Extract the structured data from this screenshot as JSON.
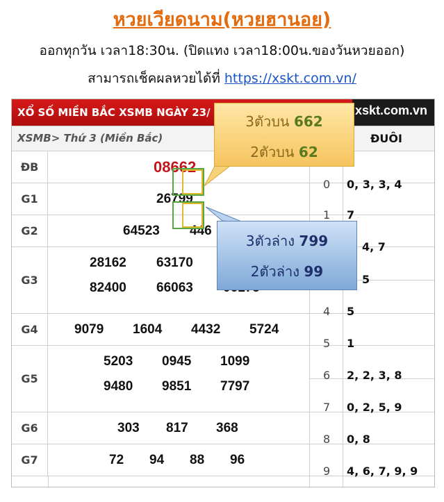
{
  "header": {
    "title": "หวยเวียดนาม(หวยฮานอย)",
    "schedule": "ออกทุกวัน เวลา18:30น. (ปิดแทง เวลา18:00น.ของวันหวยออก)",
    "check_text": "สามารถเช็คผลหวยได้ที่ ",
    "check_link": "https://xskt.com.vn/"
  },
  "board": {
    "banner": "XỔ SỐ MIỀN BẮC XSMB NGÀY 23/",
    "logo": "xskt.com.vn",
    "subheader": "XSMB> Thứ 3 (Miền Bắc)",
    "duoi_header": "ĐUÔI",
    "prizes": [
      {
        "label": "ĐB",
        "numbers": [
          "08662"
        ]
      },
      {
        "label": "G1",
        "numbers": [
          "26799"
        ]
      },
      {
        "label": "G2",
        "numbers": [
          "64523",
          "446"
        ]
      },
      {
        "label": "G3",
        "numbers": [
          "28162",
          "63170",
          "82400",
          "66063",
          "06175"
        ]
      },
      {
        "label": "G4",
        "numbers": [
          "9079",
          "1604",
          "4432",
          "5724"
        ]
      },
      {
        "label": "G5",
        "numbers": [
          "5203",
          "0945",
          "1099",
          "9480",
          "9851",
          "7797"
        ]
      },
      {
        "label": "G6",
        "numbers": [
          "303",
          "817",
          "368"
        ]
      },
      {
        "label": "G7",
        "numbers": [
          "72",
          "94",
          "88",
          "96"
        ]
      }
    ],
    "duoi": [
      {
        "digit": "0",
        "values": "0, 3, 3, 4"
      },
      {
        "digit": "1",
        "values": "7"
      },
      {
        "digit": "",
        "values": "4, 7"
      },
      {
        "digit": "",
        "values": "5"
      },
      {
        "digit": "4",
        "values": "5"
      },
      {
        "digit": "5",
        "values": "1"
      },
      {
        "digit": "6",
        "values": "2, 2, 3, 8"
      },
      {
        "digit": "7",
        "values": "0, 2, 5, 9"
      },
      {
        "digit": "8",
        "values": "0, 8"
      },
      {
        "digit": "9",
        "values": "4, 6, 7, 9, 9"
      }
    ]
  },
  "callouts": {
    "top": {
      "line1_label": "3ตัวบน ",
      "line1_value": "662",
      "line2_label": "2ตัวบน ",
      "line2_value": "62"
    },
    "bottom": {
      "line1_label": "3ตัวล่าง ",
      "line1_value": "799",
      "line2_label": "2ตัวล่าง ",
      "line2_value": "99"
    }
  },
  "colors": {
    "title": "#e36a0d",
    "banner": "#c8121a",
    "special_number": "#c0161b",
    "link": "#1a55c7"
  }
}
